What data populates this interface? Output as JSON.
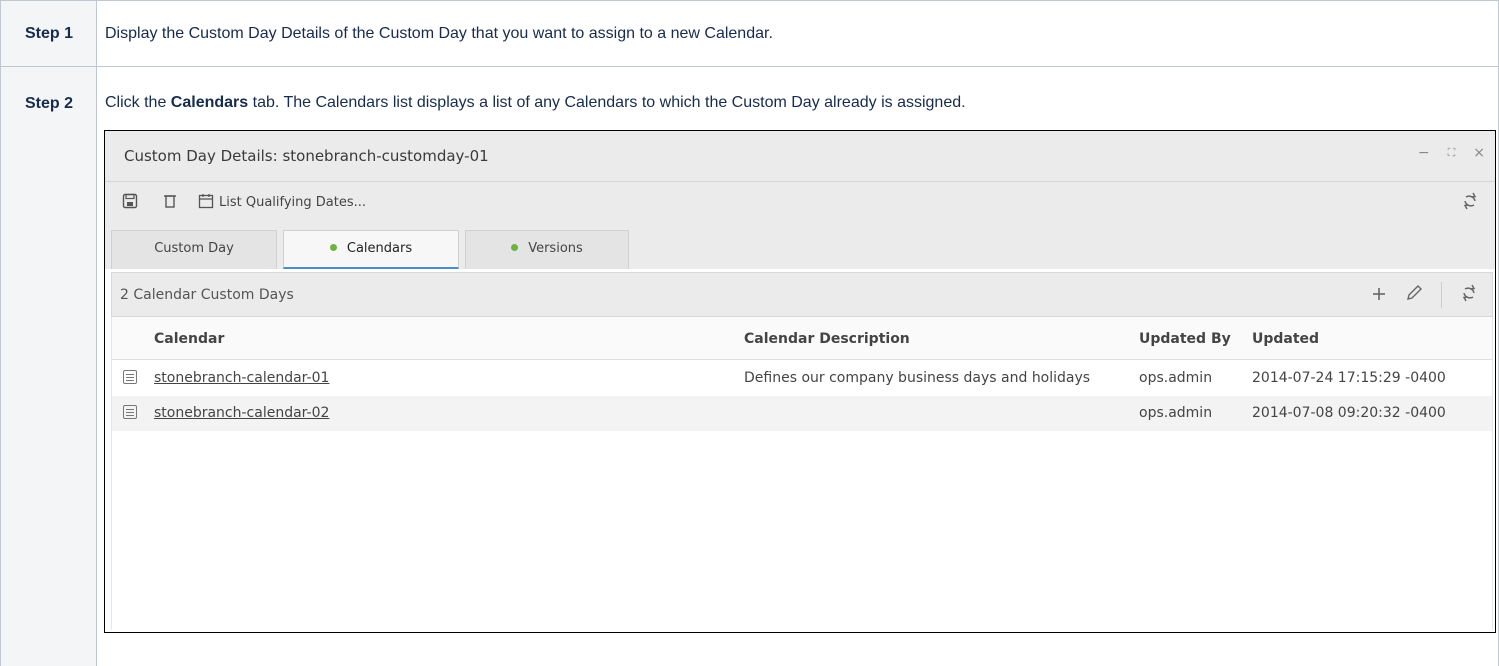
{
  "steps": [
    {
      "label": "Step 1",
      "text": "Display the Custom Day Details of the Custom Day that you want to assign to a new Calendar."
    },
    {
      "label": "Step 2",
      "text_before": "Click the ",
      "text_bold": "Calendars",
      "text_after": " tab. The Calendars list displays a list of any Calendars to which the Custom Day already is assigned."
    }
  ],
  "app": {
    "title": "Custom Day Details: stonebranch-customday-01",
    "window_controls": [
      "−",
      "⛶",
      "×"
    ],
    "toolbar": {
      "save_icon": "save-icon",
      "delete_icon": "delete-icon",
      "calendar_icon": "calendar-icon",
      "list_qualifying_label": "List Qualifying Dates...",
      "refresh_icon": "refresh-icon"
    },
    "tabs": [
      {
        "label": "Custom Day",
        "active": false,
        "dot": false
      },
      {
        "label": "Calendars",
        "active": true,
        "dot": true
      },
      {
        "label": "Versions",
        "active": false,
        "dot": true
      }
    ],
    "list": {
      "count_label": "2 Calendar Custom Days",
      "columns": [
        "Calendar",
        "Calendar Description",
        "Updated By",
        "Updated"
      ],
      "rows": [
        {
          "calendar": "stonebranch-calendar-01",
          "description": "Defines our company business days and holidays",
          "updated_by": "ops.admin",
          "updated": "2014-07-24 17:15:29 -0400"
        },
        {
          "calendar": "stonebranch-calendar-02",
          "description": "",
          "updated_by": "ops.admin",
          "updated": "2014-07-08 09:20:32 -0400"
        }
      ]
    }
  },
  "colors": {
    "active_tab_underline": "#4a90c8",
    "status_dot": "#6db33f"
  }
}
